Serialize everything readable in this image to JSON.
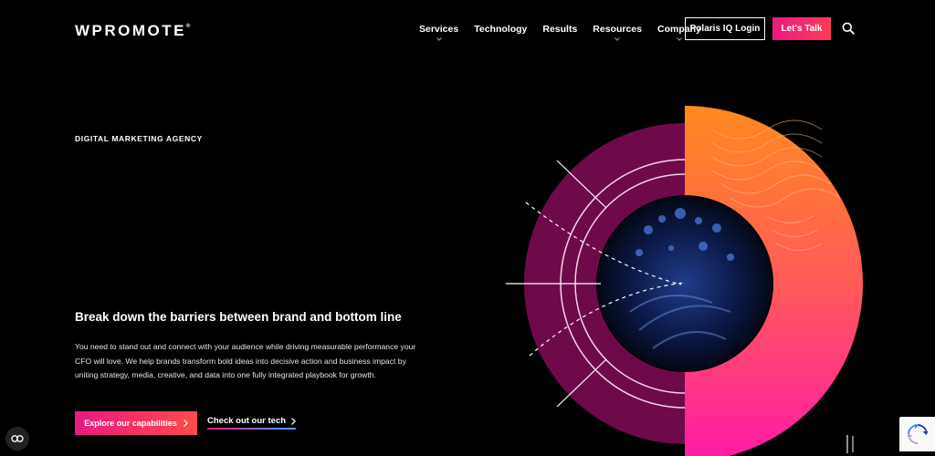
{
  "brand": {
    "logo_text": "WPROMOTE",
    "trademark": "®"
  },
  "nav": {
    "items": [
      {
        "label": "Services",
        "has_dropdown": true
      },
      {
        "label": "Technology",
        "has_dropdown": false
      },
      {
        "label": "Results",
        "has_dropdown": false
      },
      {
        "label": "Resources",
        "has_dropdown": true
      },
      {
        "label": "Company",
        "has_dropdown": true
      }
    ],
    "login_label": "Polaris IQ Login",
    "cta_label": "Let's Talk",
    "search_icon": "search-icon"
  },
  "hero": {
    "eyebrow": "DIGITAL MARKETING AGENCY",
    "headline": "Break down the barriers between brand and bottom line",
    "body": "You need to stand out and connect with your audience while driving measurable performance your CFO will love. We help brands transform bold ideas into decisive action and business impact by uniting strategy, media, creative, and data into one fully integrated playbook for growth.",
    "primary_cta": "Explore our capabilities",
    "secondary_cta": "Check out our tech"
  },
  "colors": {
    "background": "#000000",
    "accent_pink": "#ea1a7f",
    "accent_orange": "#ff7a2a",
    "ring_purple": "#6e0a4a"
  },
  "widgets": {
    "cookie_icon": "cookie-settings-icon",
    "pause_icon": "pause-icon",
    "recaptcha_icon": "recaptcha-icon"
  }
}
